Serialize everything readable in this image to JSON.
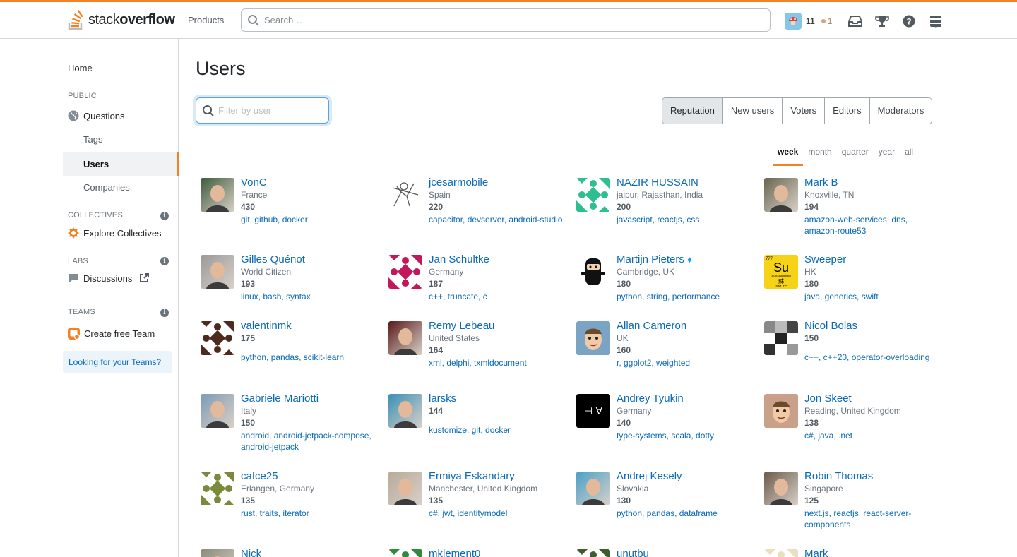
{
  "topbar": {
    "logo_text_a": "stack",
    "logo_text_b": "overflow",
    "products_label": "Products",
    "search_placeholder": "Search…",
    "reputation": "11",
    "bronze_badges": "1"
  },
  "sidebar": {
    "home": "Home",
    "public_header": "PUBLIC",
    "questions": "Questions",
    "tags": "Tags",
    "users": "Users",
    "companies": "Companies",
    "collectives_header": "COLLECTIVES",
    "explore_collectives": "Explore Collectives",
    "labs_header": "LABS",
    "discussions": "Discussions",
    "teams_header": "TEAMS",
    "create_team": "Create free Team",
    "looking_for_teams": "Looking for your Teams?"
  },
  "main": {
    "title": "Users",
    "filter_placeholder": "Filter by user",
    "tabs": [
      "Reputation",
      "New users",
      "Voters",
      "Editors",
      "Moderators"
    ],
    "active_tab": "Reputation",
    "periods": [
      "week",
      "month",
      "quarter",
      "year",
      "all"
    ],
    "active_period": "week"
  },
  "users": [
    {
      "name": "VonC",
      "location": "France",
      "rep": "430",
      "tags": "git, github, docker",
      "avatar": "photo",
      "color": "#3d5a3a"
    },
    {
      "name": "jcesarmobile",
      "location": "Spain",
      "rep": "220",
      "tags": "capacitor, devserver, android-studio",
      "avatar": "sketch",
      "color": "#dddddd"
    },
    {
      "name": "NAZIR HUSSAIN",
      "location": "jaipur, Rajasthan, India",
      "rep": "200",
      "tags": "javascript, reactjs, css",
      "avatar": "identicon",
      "color": "#2dbf8f"
    },
    {
      "name": "Mark B",
      "location": "Knoxville, TN",
      "rep": "194",
      "tags": "amazon-web-services, dns, amazon-route53",
      "avatar": "photo",
      "color": "#6a6550"
    },
    {
      "name": "Gilles Quénot",
      "location": "World Citizen",
      "rep": "193",
      "tags": "linux, bash, syntax",
      "avatar": "photo",
      "color": "#9a9a9a"
    },
    {
      "name": "Jan Schultke",
      "location": "Germany",
      "rep": "187",
      "tags": "c++, truncate, c",
      "avatar": "identicon",
      "color": "#c2185b"
    },
    {
      "name": "Martijn Pieters",
      "moderator": "♦",
      "location": "Cambridge, UK",
      "rep": "180",
      "tags": "python, string, performance",
      "avatar": "ninja",
      "color": "#111111"
    },
    {
      "name": "Sweeper",
      "location": "HK",
      "rep": "180",
      "tags": "java, generics, swift",
      "avatar": "element",
      "color": "#f7d318",
      "element_symbol": "Su",
      "element_name": "Sumulangium",
      "element_glyph": "蘇",
      "element_mass": "1554.777",
      "element_number": "777"
    },
    {
      "name": "valentinmk",
      "location": "",
      "rep": "175",
      "tags": "python, pandas, scikit-learn",
      "avatar": "identicon",
      "color": "#4e2a1e"
    },
    {
      "name": "Remy Lebeau",
      "location": "United States",
      "rep": "164",
      "tags": "xml, delphi, txmldocument",
      "avatar": "photo",
      "color": "#5a1a1a"
    },
    {
      "name": "Allan Cameron",
      "location": "UK",
      "rep": "160",
      "tags": "r, ggplot2, weighted",
      "avatar": "cartoon",
      "color": "#7aa3c4"
    },
    {
      "name": "Nicol Bolas",
      "location": "",
      "rep": "150",
      "tags": "c++, c++20, operator-overloading",
      "avatar": "checker",
      "color": "#555555"
    },
    {
      "name": "Gabriele Mariotti",
      "location": "Italy",
      "rep": "150",
      "tags": "android, android-jetpack-compose, android-jetpack",
      "avatar": "photo",
      "color": "#7d9bb5"
    },
    {
      "name": "larsks",
      "location": "",
      "rep": "144",
      "tags": "kustomize, git, docker",
      "avatar": "photo",
      "color": "#3a8fb5"
    },
    {
      "name": "Andrey Tyukin",
      "location": "Germany",
      "rep": "140",
      "tags": "type-systems, scala, dotty",
      "avatar": "logic",
      "color": "#000000",
      "logic_text": "⊣ ∀"
    },
    {
      "name": "Jon Skeet",
      "location": "Reading, United Kingdom",
      "rep": "138",
      "tags": "c#, java, .net",
      "avatar": "cartoon",
      "color": "#c9a08a"
    },
    {
      "name": "cafce25",
      "location": "Erlangen, Germany",
      "rep": "135",
      "tags": "rust, traits, iterator",
      "avatar": "identicon",
      "color": "#7a8a3a"
    },
    {
      "name": "Ermiya Eskandary",
      "location": "Manchester, United Kingdom",
      "rep": "135",
      "tags": "c#, jwt, identitymodel",
      "avatar": "photo",
      "color": "#b8aa98"
    },
    {
      "name": "Andrej Kesely",
      "location": "Slovakia",
      "rep": "130",
      "tags": "python, pandas, dataframe",
      "avatar": "photo",
      "color": "#4aa0c8"
    },
    {
      "name": "Robin Thomas",
      "location": "Singapore",
      "rep": "125",
      "tags": "next.js, reactjs, react-server-components",
      "avatar": "photo",
      "color": "#6b5a4a"
    },
    {
      "name": "Nick",
      "location": "",
      "rep": "",
      "tags": "",
      "avatar": "photo",
      "color": "#8a8a7a"
    },
    {
      "name": "mklement0",
      "location": "",
      "rep": "",
      "tags": "",
      "avatar": "identicon",
      "color": "#2e8b3e"
    },
    {
      "name": "unutbu",
      "location": "",
      "rep": "",
      "tags": "",
      "avatar": "identicon",
      "color": "#3b5e2b"
    },
    {
      "name": "Mark",
      "location": "",
      "rep": "",
      "tags": "",
      "avatar": "identicon",
      "color": "#e8e0c0"
    }
  ]
}
